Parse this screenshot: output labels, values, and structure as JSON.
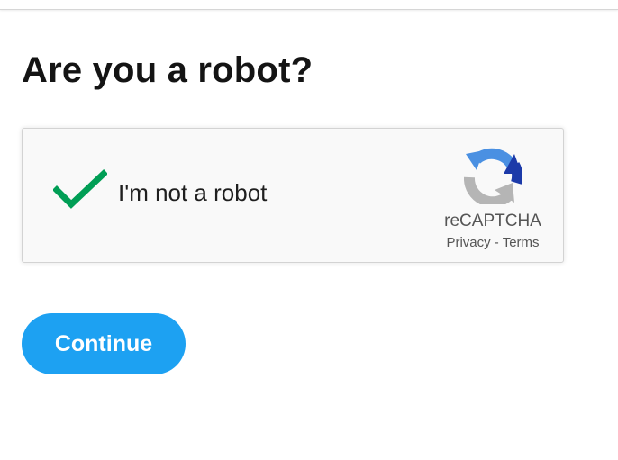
{
  "page": {
    "title": "Are you a robot?"
  },
  "recaptcha": {
    "checkbox_label": "I'm not a robot",
    "checked": true,
    "check_icon": "checkmark-icon",
    "logo_icon": "recaptcha-logo-icon",
    "brand": "reCAPTCHA",
    "privacy_link": "Privacy",
    "separator": " - ",
    "terms_link": "Terms"
  },
  "actions": {
    "continue_label": "Continue"
  },
  "colors": {
    "accent": "#1da1f2",
    "check": "#009e55",
    "logo_blue": "#4a90e2",
    "logo_dark_blue": "#1c3aa9",
    "logo_gray": "#b5b5b5"
  }
}
